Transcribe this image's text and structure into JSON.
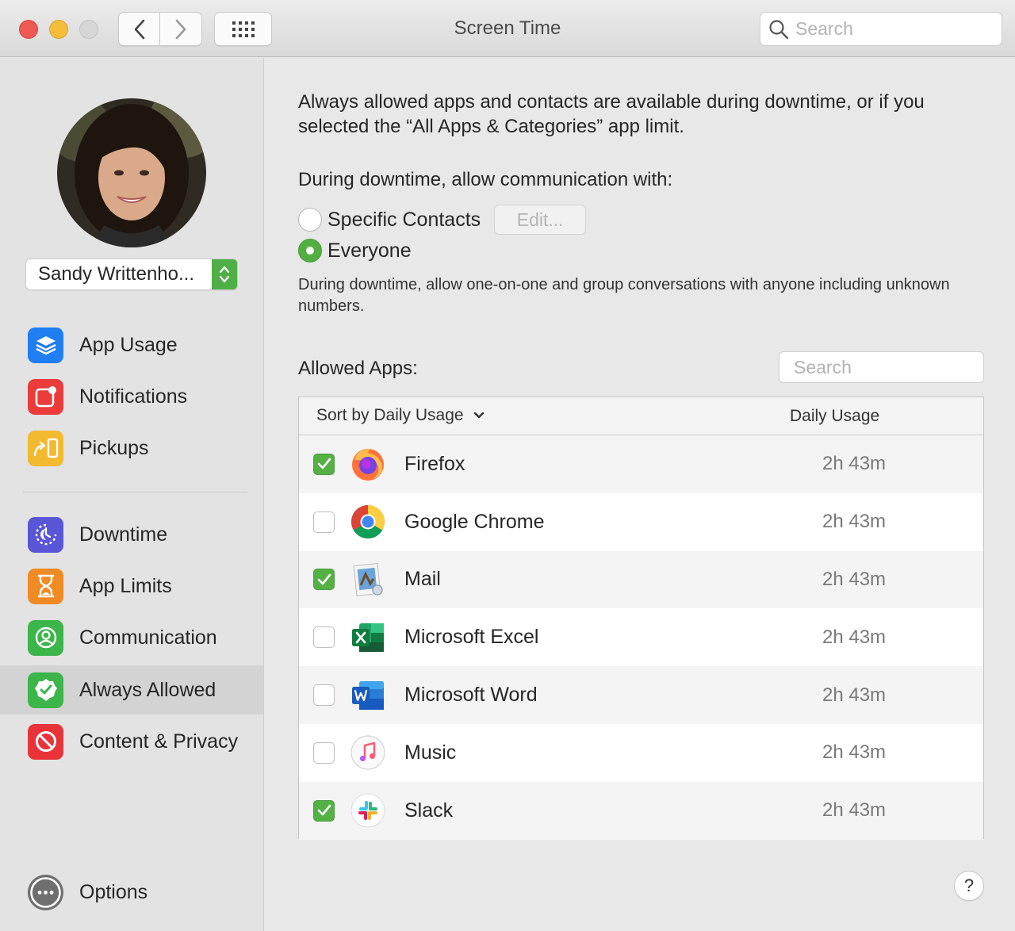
{
  "window": {
    "title": "Screen Time",
    "search_placeholder": "Search"
  },
  "sidebar": {
    "user_name": "Sandy Writtenho...",
    "group1": [
      {
        "label": "App Usage",
        "icon": "layers-icon",
        "color": "#1f7ef2"
      },
      {
        "label": "Notifications",
        "icon": "notification-badge-icon",
        "color": "#eb3b3b"
      },
      {
        "label": "Pickups",
        "icon": "pickup-icon",
        "color": "#f3b92f"
      }
    ],
    "group2": [
      {
        "label": "Downtime",
        "icon": "downtime-icon",
        "color": "#5856d6"
      },
      {
        "label": "App Limits",
        "icon": "hourglass-icon",
        "color": "#f08a24"
      },
      {
        "label": "Communication",
        "icon": "person-circle-icon",
        "color": "#3cb54a"
      },
      {
        "label": "Always Allowed",
        "icon": "checkmark-seal-icon",
        "color": "#3cb54a",
        "selected": true
      },
      {
        "label": "Content & Privacy",
        "icon": "prohibited-icon",
        "color": "#e8333a"
      }
    ],
    "options_label": "Options"
  },
  "main": {
    "intro": "Always allowed apps and contacts are available during downtime, or if you selected the “All Apps & Categories” app limit.",
    "downtime_label": "During downtime, allow communication with:",
    "radio_specific": "Specific Contacts",
    "edit_button": "Edit...",
    "radio_everyone": "Everyone",
    "selected_option": "Everyone",
    "help_text": "During downtime, allow one-on-one and group conversations with anyone including unknown numbers.",
    "allowed_apps_label": "Allowed Apps:",
    "search_placeholder": "Search",
    "sort_label": "Sort by Daily Usage",
    "column_usage": "Daily Usage",
    "apps": [
      {
        "name": "Firefox",
        "usage": "2h 43m",
        "checked": true,
        "icon": "firefox-icon"
      },
      {
        "name": "Google Chrome",
        "usage": "2h 43m",
        "checked": false,
        "icon": "chrome-icon"
      },
      {
        "name": "Mail",
        "usage": "2h 43m",
        "checked": true,
        "icon": "mail-icon"
      },
      {
        "name": "Microsoft Excel",
        "usage": "2h 43m",
        "checked": false,
        "icon": "excel-icon"
      },
      {
        "name": "Microsoft Word",
        "usage": "2h 43m",
        "checked": false,
        "icon": "word-icon"
      },
      {
        "name": "Music",
        "usage": "2h 43m",
        "checked": false,
        "icon": "music-icon"
      },
      {
        "name": "Slack",
        "usage": "2h 43m",
        "checked": true,
        "icon": "slack-icon"
      }
    ],
    "help_button": "?"
  }
}
